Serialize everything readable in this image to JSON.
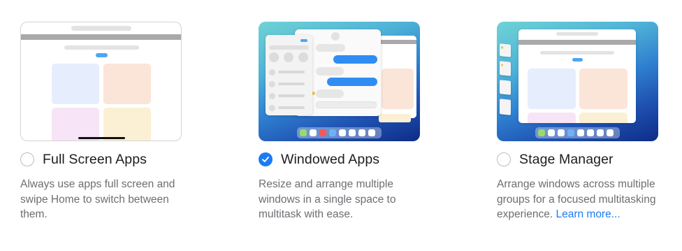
{
  "options": [
    {
      "id": "full-screen",
      "label": "Full Screen Apps",
      "description": "Always use apps full screen and swipe Home to switch between them.",
      "selected": false
    },
    {
      "id": "windowed",
      "label": "Windowed Apps",
      "description": "Resize and arrange multiple windows in a single space to multitask with ease.",
      "selected": true
    },
    {
      "id": "stage-manager",
      "label": "Stage Manager",
      "description": "Arrange windows across multiple groups for a focused multitasking experience.",
      "link_text": "Learn more...",
      "selected": false
    }
  ],
  "colors": {
    "accent": "#1a7cf5",
    "label": "#1d1d1f",
    "description": "#6e6e73"
  }
}
